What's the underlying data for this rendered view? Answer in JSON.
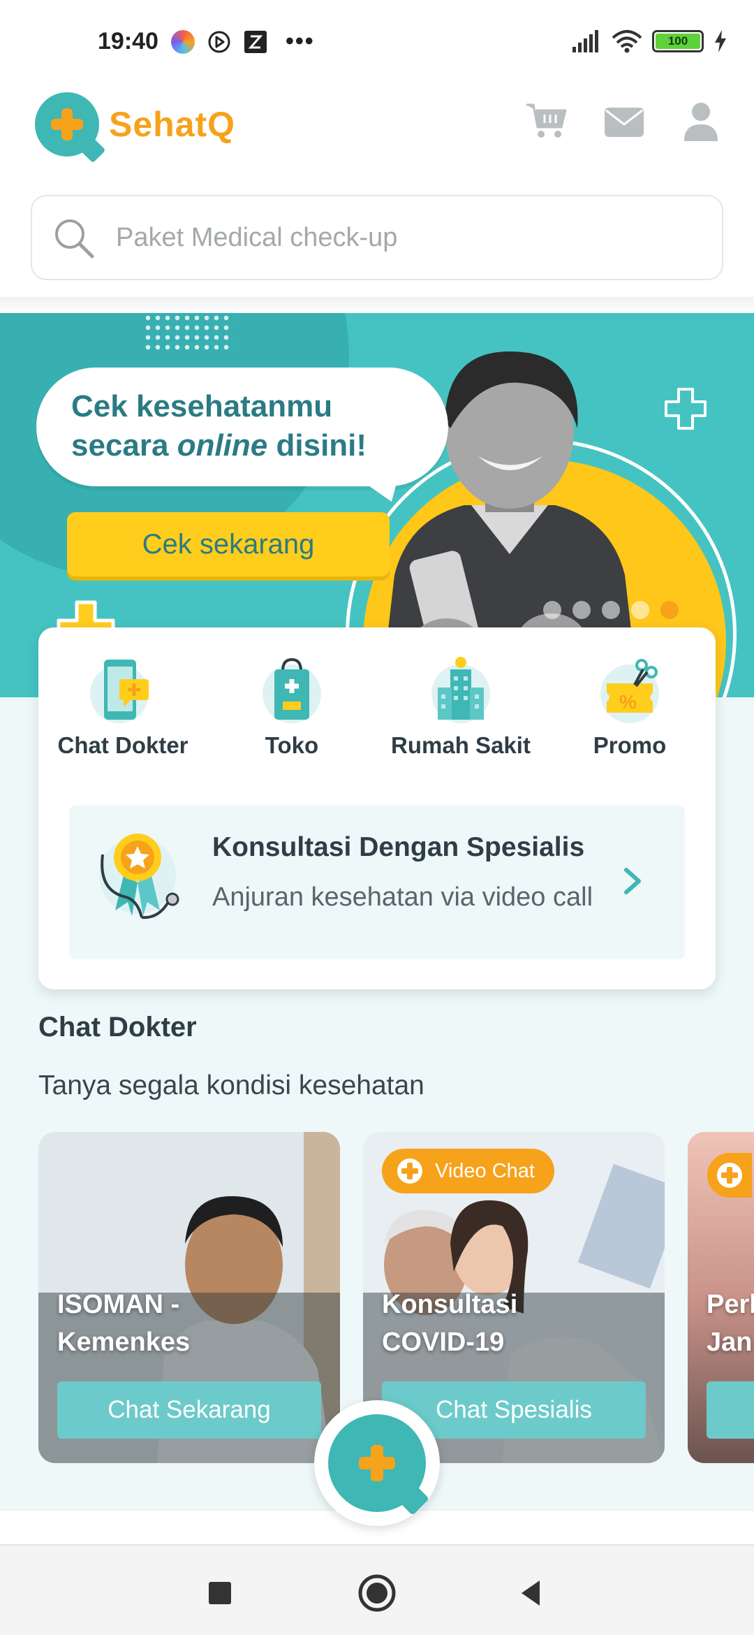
{
  "status_bar": {
    "time": "19:40",
    "battery": "100"
  },
  "app": {
    "name": "SehatQ"
  },
  "search": {
    "placeholder": "Paket Medical check-up"
  },
  "banner": {
    "line1": "Cek kesehatanmu",
    "line2_prefix": "secara ",
    "line2_emph": "online",
    "line2_suffix": " disini!",
    "cta": "Cek sekarang",
    "slides": 5,
    "active_slide": 5
  },
  "menu": {
    "items": [
      {
        "label": "Chat Dokter",
        "icon": "chat-doctor-icon"
      },
      {
        "label": "Toko",
        "icon": "shop-bag-icon"
      },
      {
        "label": "Rumah Sakit",
        "icon": "hospital-icon"
      },
      {
        "label": "Promo",
        "icon": "promo-ticket-icon"
      }
    ],
    "specialist": {
      "title": "Konsultasi Dengan Spesialis",
      "subtitle": "Anjuran kesehatan via video call"
    }
  },
  "chat_section": {
    "title": "Chat Dokter",
    "subtitle": "Tanya segala kondisi kesehatan",
    "cards": [
      {
        "title_line1": "ISOMAN -",
        "title_line2": "Kemenkes",
        "button": "Chat Sekarang"
      },
      {
        "badge": "Video Chat",
        "title_line1": "Konsultasi",
        "title_line2": "COVID-19",
        "button": "Chat Spesialis"
      },
      {
        "title_line1": "Perl",
        "title_line2": "Jan"
      }
    ]
  },
  "colors": {
    "brand_teal": "#3fb7b4",
    "brand_orange": "#f7a21b",
    "banner_bg": "#45c3c2",
    "cta_yellow": "#ffcd1c",
    "card_button": "#6ccaca"
  }
}
